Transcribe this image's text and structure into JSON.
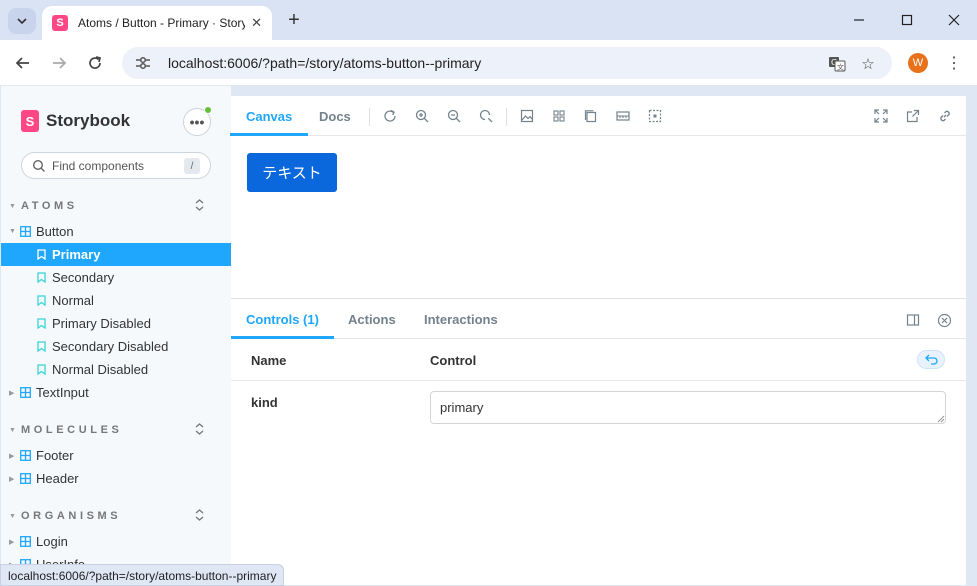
{
  "browser": {
    "tab_title": "Atoms / Button - Primary · Storybook",
    "url": "localhost:6006/?path=/story/atoms-button--primary",
    "profile_initial": "W",
    "status_url": "localhost:6006/?path=/story/atoms-button--primary"
  },
  "sidebar": {
    "brand": "Storybook",
    "menu_label": "•••",
    "search_placeholder": "Find components",
    "search_shortcut": "/",
    "groups": [
      {
        "label": "ATOMS"
      },
      {
        "label": "MOLECULES"
      },
      {
        "label": "ORGANISMS"
      }
    ],
    "components": {
      "button": "Button",
      "textinput": "TextInput",
      "footer": "Footer",
      "header": "Header",
      "login": "Login",
      "userinfo": "UserInfo"
    },
    "stories": [
      {
        "label": "Primary",
        "active": true
      },
      {
        "label": "Secondary",
        "active": false
      },
      {
        "label": "Normal",
        "active": false
      },
      {
        "label": "Primary Disabled",
        "active": false
      },
      {
        "label": "Secondary Disabled",
        "active": false
      },
      {
        "label": "Normal Disabled",
        "active": false
      }
    ]
  },
  "toolbar": {
    "tabs": [
      {
        "label": "Canvas",
        "active": true
      },
      {
        "label": "Docs",
        "active": false
      }
    ],
    "icons": [
      "reload-icon",
      "zoom-in-icon",
      "zoom-out-icon",
      "zoom-reset-icon",
      "background-icon",
      "grid-icon",
      "viewport-icon",
      "measure-icon",
      "outline-icon",
      "fullscreen-icon",
      "open-new-tab-icon",
      "copy-link-icon"
    ]
  },
  "canvas": {
    "button_label": "テキスト"
  },
  "addons": {
    "tabs": [
      {
        "label": "Controls (1)",
        "active": true
      },
      {
        "label": "Actions",
        "active": false
      },
      {
        "label": "Interactions",
        "active": false
      }
    ],
    "columns": {
      "name": "Name",
      "control": "Control"
    },
    "rows": [
      {
        "name": "kind",
        "value": "primary"
      }
    ]
  },
  "colors": {
    "accent": "#1ea7fd",
    "button_primary": "#0a68dc",
    "brand": "#ff4785"
  }
}
